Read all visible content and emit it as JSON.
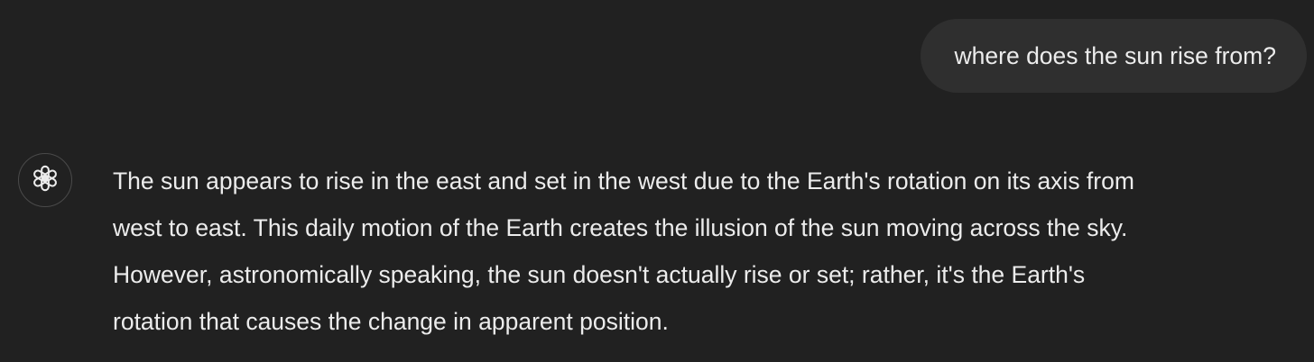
{
  "conversation": {
    "user_message": {
      "text": "where does the sun rise from?"
    },
    "assistant_message": {
      "avatar_icon": "openai-logo-icon",
      "lines": [
        "The sun appears to rise in the east and set in the west due to the Earth's rotation on its axis from",
        "west to east. This daily motion of the Earth creates the illusion of the sun moving across the sky.",
        "However, astronomically speaking, the sun doesn't actually rise or set; rather, it's the Earth's",
        "rotation that causes the change in apparent position."
      ]
    }
  },
  "colors": {
    "background": "#212121",
    "user_bubble": "#2f2f2f",
    "text": "#ececec"
  }
}
